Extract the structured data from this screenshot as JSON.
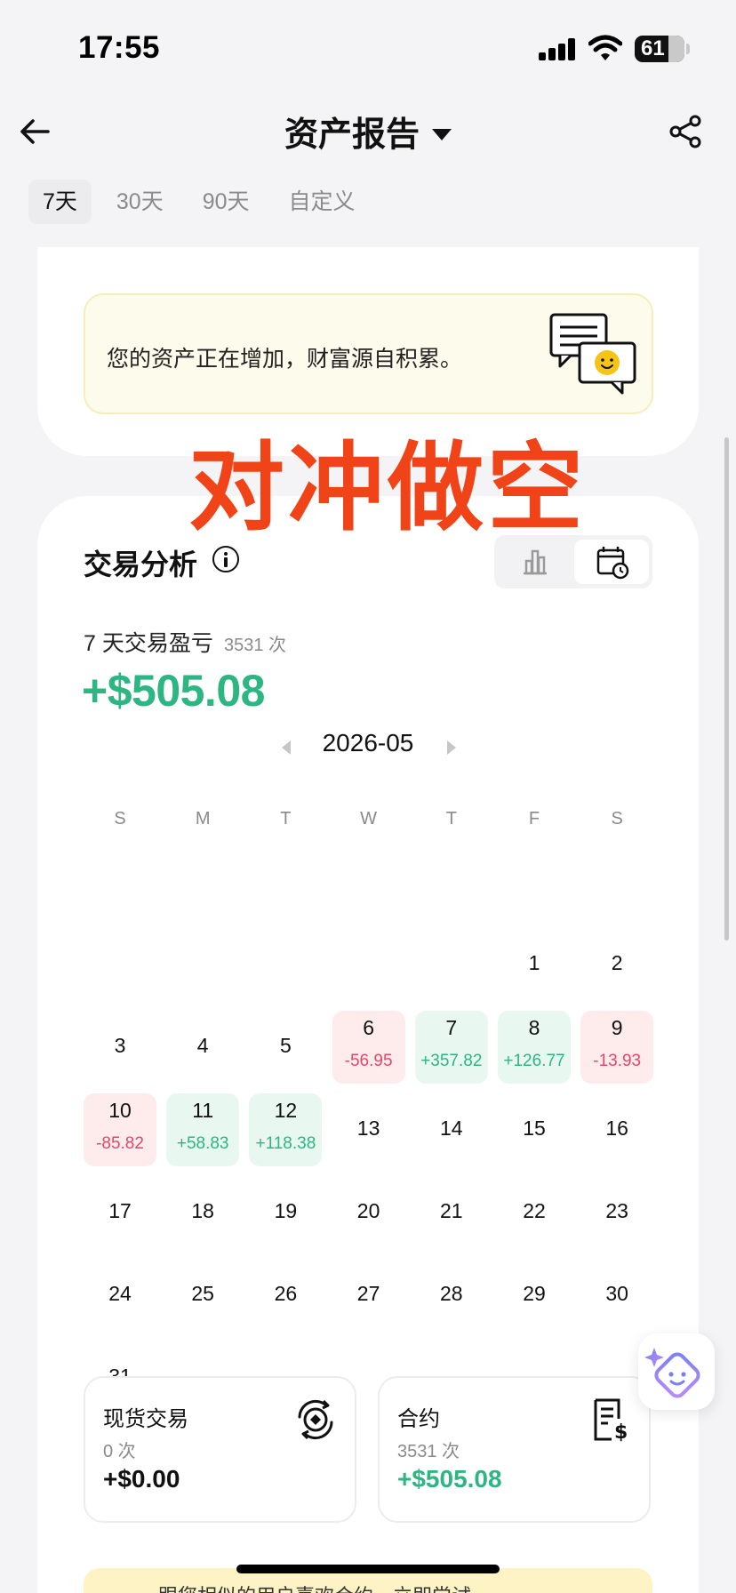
{
  "status_bar": {
    "time": "17:55",
    "battery": "61"
  },
  "nav": {
    "title": "资产报告"
  },
  "tabs": [
    {
      "label": "7天",
      "active": true
    },
    {
      "label": "30天",
      "active": false
    },
    {
      "label": "90天",
      "active": false
    },
    {
      "label": "自定义",
      "active": false
    }
  ],
  "banner": {
    "text": "您的资产正在增加，财富源自积累。"
  },
  "watermark": "对冲做空",
  "analysis": {
    "title": "交易分析",
    "pnl_label": "7 天交易盈亏",
    "trade_count": "3531 次",
    "pnl_value": "+$505.08"
  },
  "calendar": {
    "month": "2026-05",
    "weekdays": [
      "S",
      "M",
      "T",
      "W",
      "T",
      "F",
      "S"
    ],
    "first_weekday": 5,
    "days_in_month": 31,
    "pnl": {
      "6": "-56.95",
      "7": "+357.82",
      "8": "+126.77",
      "9": "-13.93",
      "10": "-85.82",
      "11": "+58.83",
      "12": "+118.38"
    }
  },
  "spot": {
    "title": "现货交易",
    "count": "0 次",
    "value": "+$0.00"
  },
  "futures": {
    "title": "合约",
    "count": "3531 次",
    "value": "+$505.08"
  },
  "bottom_banner": {
    "text": "跟您相似的用户喜欢合约，立即尝试"
  },
  "colors": {
    "positive": "#2db682",
    "negative": "#e2486b",
    "watermark": "#f04418"
  }
}
